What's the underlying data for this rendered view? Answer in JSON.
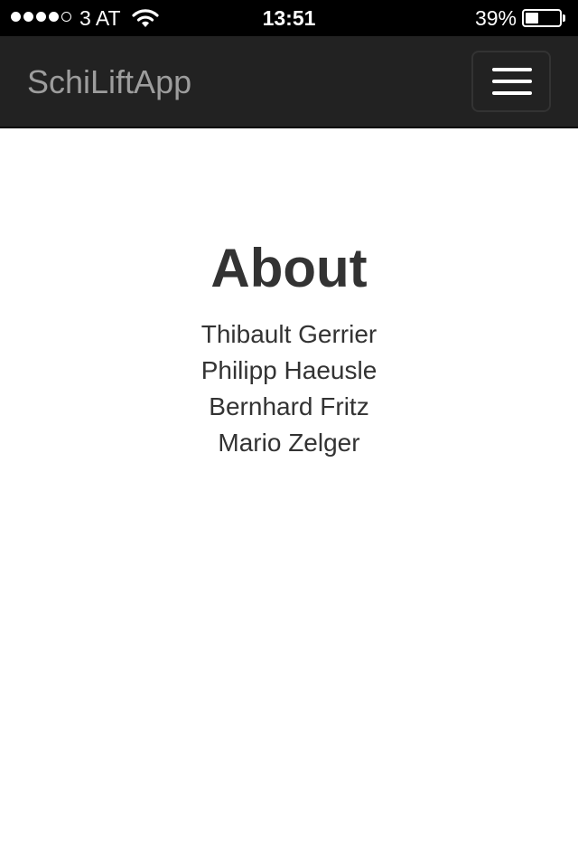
{
  "status_bar": {
    "signal_strength": "4 of 5",
    "carrier": "3 AT",
    "wifi_icon": "wifi-icon",
    "time": "13:51",
    "battery_percent_label": "39%",
    "battery_level": 0.39
  },
  "navbar": {
    "brand": "SchiLiftApp",
    "menu_icon": "hamburger-menu-icon",
    "background": "#222222",
    "brand_color": "#9d9d9d"
  },
  "main": {
    "title": "About",
    "names": [
      "Thibault Gerrier",
      "Philipp Haeusle",
      "Bernhard Fritz",
      "Mario Zelger"
    ],
    "text_color": "#333333"
  }
}
